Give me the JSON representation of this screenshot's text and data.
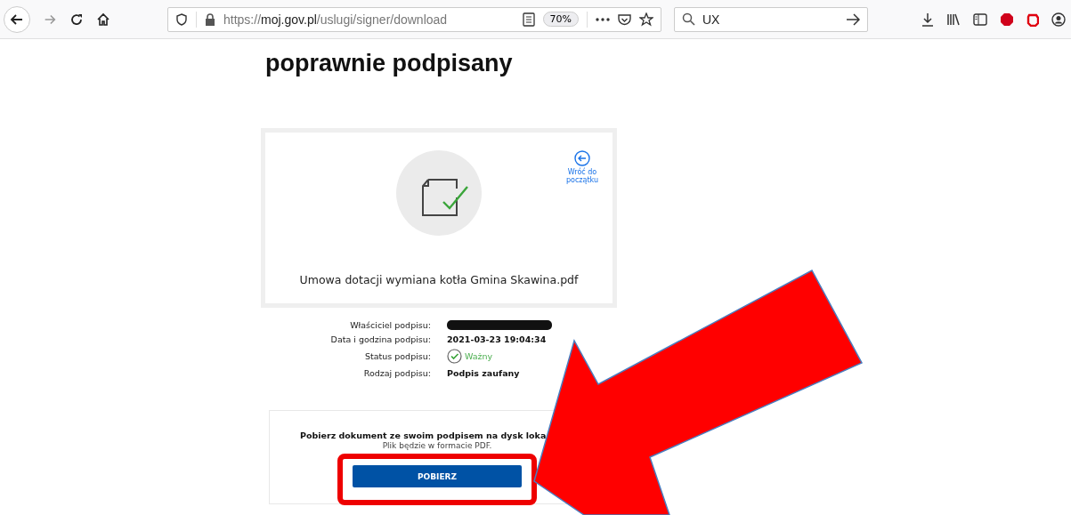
{
  "browser": {
    "url_scheme": "https://",
    "url_host": "moj.gov.pl",
    "url_path": "/uslugi/signer/download",
    "zoom": "70%",
    "search": "UX"
  },
  "heading": "poprawnie podpisany",
  "document_card": {
    "file_name": "Umowa dotacji wymiana kotła Gmina Skawina.pdf",
    "back_link": "Wróć do początku"
  },
  "details": [
    {
      "label": "Właściciel podpisu:",
      "kind": "redacted"
    },
    {
      "label": "Data i godzina podpisu:",
      "kind": "bold",
      "value": "2021-03-23 19:04:34"
    },
    {
      "label": "Status podpisu:",
      "kind": "status",
      "value": "Ważny"
    },
    {
      "label": "Rodzaj podpisu:",
      "kind": "bold",
      "value": "Podpis zaufany"
    }
  ],
  "download": {
    "text": "Pobierz dokument ze swoim podpisem na dysk loka",
    "note": "Plik będzie w formacie PDF.",
    "button": "POBIERZ"
  },
  "annotations": [
    {
      "kind": "frame"
    },
    {
      "kind": "arrow"
    }
  ]
}
